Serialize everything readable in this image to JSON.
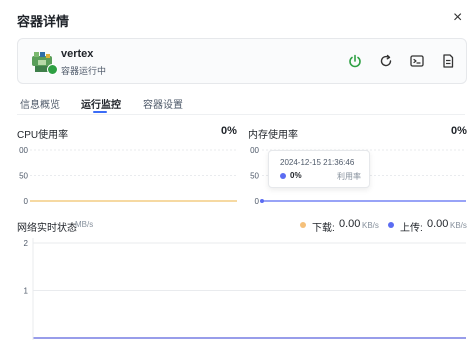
{
  "dialog": {
    "title": "容器详情",
    "close_icon": "close-icon"
  },
  "container": {
    "name": "vertex",
    "status": "容器运行中",
    "status_color": "#2ea043",
    "actions": [
      "power-icon",
      "restart-icon",
      "terminal-icon",
      "logs-icon"
    ]
  },
  "tabs": [
    {
      "label": "信息概览",
      "active": false
    },
    {
      "label": "运行监控",
      "active": true
    },
    {
      "label": "容器设置",
      "active": false
    }
  ],
  "cpu": {
    "title": "CPU使用率",
    "value": "0%"
  },
  "memory": {
    "title": "内存使用率",
    "value": "0%"
  },
  "tooltip": {
    "time": "2024-12-15 21:36:46",
    "value": "0%",
    "series": "利用率"
  },
  "network": {
    "title": "网络实时状态",
    "unit": "MB/s",
    "download_label": "下载:",
    "download_value": "0.00",
    "download_unit": "KB/s",
    "upload_label": "上传:",
    "upload_value": "0.00",
    "upload_unit": "KB/s"
  },
  "colors": {
    "accent": "#3b6cf6",
    "cpu_line": "#f0c26b",
    "memory_line": "#5b6cf2",
    "download": "#f5c07a",
    "upload": "#5b6cf2"
  },
  "chart_data": [
    {
      "type": "line",
      "title": "CPU使用率",
      "y_ticks": [
        "0",
        "50",
        "00"
      ],
      "series": [
        {
          "values": [
            0,
            0
          ]
        }
      ],
      "ylim": [
        0,
        100
      ],
      "grid": true
    },
    {
      "type": "line",
      "title": "内存使用率",
      "y_ticks": [
        "0",
        "50",
        "00"
      ],
      "series": [
        {
          "values": [
            0,
            0
          ]
        }
      ],
      "ylim": [
        0,
        100
      ],
      "grid": true
    },
    {
      "type": "line",
      "title": "网络实时状态",
      "y_ticks": [
        "1",
        "2"
      ],
      "series": [
        {
          "name": "下载",
          "values": [
            0,
            0
          ]
        },
        {
          "name": "上传",
          "values": [
            0,
            0
          ]
        }
      ],
      "ylim": [
        0,
        2
      ],
      "grid": true
    }
  ]
}
